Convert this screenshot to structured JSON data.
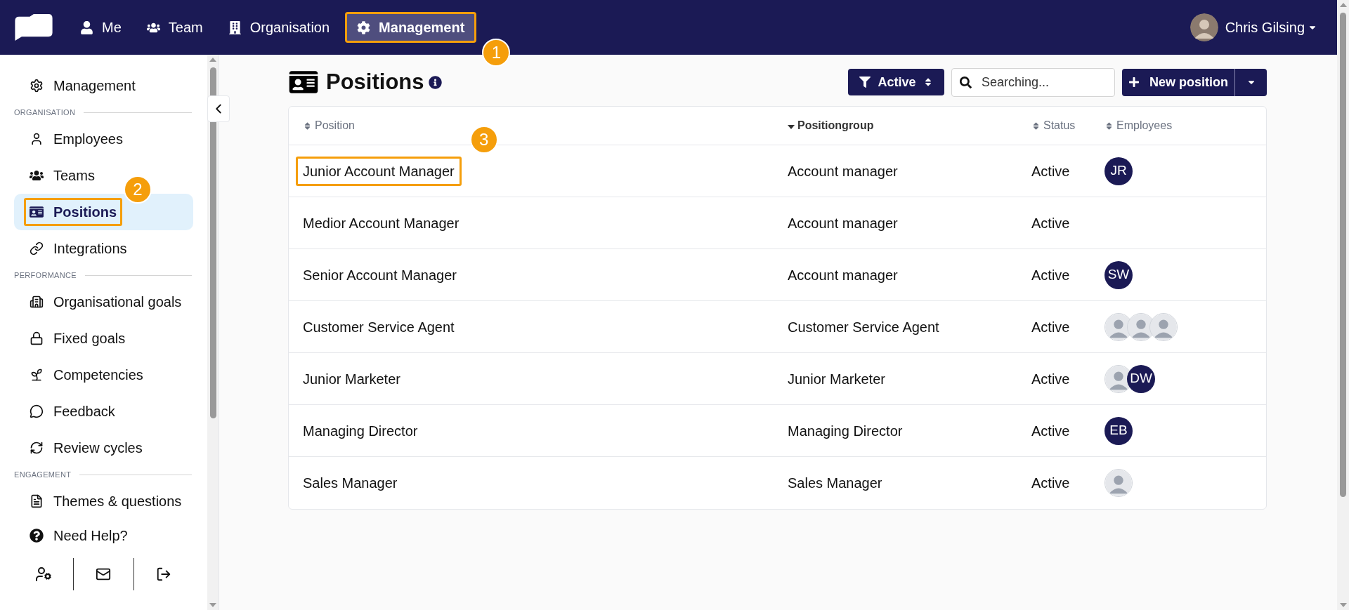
{
  "nav": {
    "items": [
      {
        "label": "Me",
        "selected": false
      },
      {
        "label": "Team",
        "selected": false
      },
      {
        "label": "Organisation",
        "selected": false
      },
      {
        "label": "Management",
        "selected": true,
        "callout": "1"
      }
    ],
    "user": {
      "name": "Chris Gilsing"
    }
  },
  "sidebar": {
    "groups": [
      {
        "items": [
          {
            "label": "Management",
            "selected": false
          }
        ]
      },
      {
        "title": "ORGANISATION",
        "items": [
          {
            "label": "Employees",
            "selected": false
          },
          {
            "label": "Teams",
            "selected": false
          },
          {
            "label": "Positions",
            "selected": true,
            "callout": "2"
          },
          {
            "label": "Integrations",
            "selected": false
          }
        ]
      },
      {
        "title": "PERFORMANCE",
        "items": [
          {
            "label": "Organisational goals",
            "selected": false
          },
          {
            "label": "Fixed goals",
            "selected": false
          },
          {
            "label": "Competencies",
            "selected": false
          },
          {
            "label": "Feedback",
            "selected": false
          },
          {
            "label": "Review cycles",
            "selected": false
          }
        ]
      },
      {
        "title": "ENGAGEMENT",
        "items": [
          {
            "label": "Themes & questions",
            "selected": false
          }
        ]
      }
    ],
    "help": "Need Help?"
  },
  "page": {
    "title": "Positions",
    "filter": "Active",
    "search": {
      "placeholder": "Searching..."
    },
    "new_button": "New position"
  },
  "table": {
    "columns": [
      {
        "label": "Position",
        "sorted": false
      },
      {
        "label": "Positiongroup",
        "sorted": true
      },
      {
        "label": "Status",
        "sorted": false
      },
      {
        "label": "Employees",
        "sorted": false
      }
    ],
    "rows": [
      {
        "position": "Junior Account Manager",
        "callout": "3",
        "group": "Account manager",
        "status": "Active",
        "employees": [
          {
            "kind": "initials",
            "initials": "JR"
          }
        ]
      },
      {
        "position": "Medior Account Manager",
        "group": "Account manager",
        "status": "Active",
        "employees": []
      },
      {
        "position": "Senior Account Manager",
        "group": "Account manager",
        "status": "Active",
        "employees": [
          {
            "kind": "initials",
            "initials": "SW"
          }
        ]
      },
      {
        "position": "Customer Service Agent",
        "group": "Customer Service Agent",
        "status": "Active",
        "employees": [
          {
            "kind": "photo"
          },
          {
            "kind": "photo"
          },
          {
            "kind": "photo"
          }
        ]
      },
      {
        "position": "Junior Marketer",
        "group": "Junior Marketer",
        "status": "Active",
        "employees": [
          {
            "kind": "photo"
          },
          {
            "kind": "initials",
            "initials": "DW"
          }
        ]
      },
      {
        "position": "Managing Director",
        "group": "Managing Director",
        "status": "Active",
        "employees": [
          {
            "kind": "initials",
            "initials": "EB"
          }
        ]
      },
      {
        "position": "Sales Manager",
        "group": "Sales Manager",
        "status": "Active",
        "employees": [
          {
            "kind": "photo"
          }
        ]
      }
    ]
  }
}
